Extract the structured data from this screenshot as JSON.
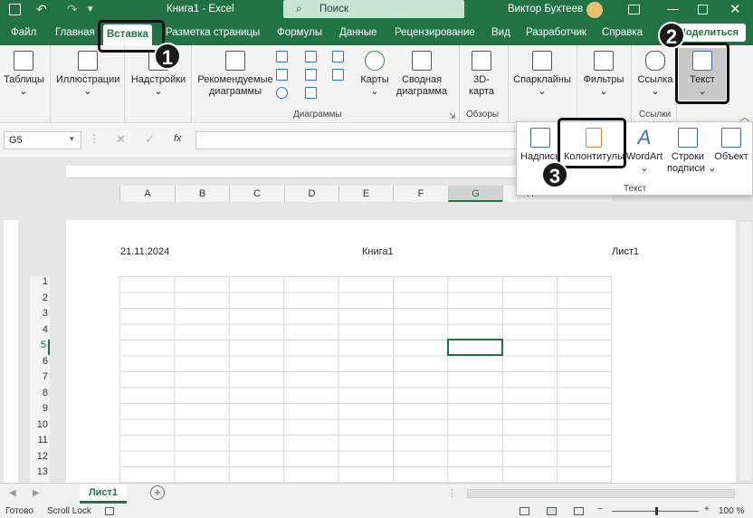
{
  "titlebar": {
    "title": "Книга1 - Excel",
    "search_placeholder": "Поиск",
    "user": "Виктор Бухтеев",
    "share": "Поделиться"
  },
  "tabs": [
    "Файл",
    "Главная",
    "Вставка",
    "Разметка страницы",
    "Формулы",
    "Данные",
    "Рецензирование",
    "Вид",
    "Разработчик",
    "Справка"
  ],
  "ribbon": {
    "tables": "Таблицы",
    "illustrations": "Иллюстрации",
    "addins": "Надстройки",
    "recommended_charts_1": "Рекомендуемые",
    "recommended_charts_2": "диаграммы",
    "maps": "Карты",
    "pivot_1": "Сводная",
    "pivot_2": "диаграмма",
    "map3d_1": "3D-",
    "map3d_2": "карта",
    "sparklines": "Спарклайны",
    "filters": "Фильтры",
    "link": "Ссылка",
    "text": "Текст",
    "group_charts": "Диаграммы",
    "group_tours": "Обзоры",
    "group_links": "Ссылки"
  },
  "formula_bar": {
    "namebox": "G5",
    "fx": "fx"
  },
  "popup": {
    "textbox": "Надпись",
    "headers": "Колонтитулы",
    "wordart": "WordArt",
    "sigline_1": "Строки",
    "sigline_2": "подписи",
    "object": "Объект",
    "group": "Текст"
  },
  "callouts": [
    "1",
    "2",
    "3"
  ],
  "columns": [
    "A",
    "B",
    "C",
    "D",
    "E",
    "F",
    "G",
    "H"
  ],
  "header": {
    "left": "21.11.2024",
    "center": "Книга1",
    "right": "Лист1"
  },
  "rows": [
    "1",
    "2",
    "3",
    "4",
    "5",
    "6",
    "7",
    "8",
    "9",
    "10",
    "11",
    "12",
    "13"
  ],
  "sheet_tab": "Лист1",
  "status": {
    "ready": "Готово",
    "scroll": "Scroll Lock",
    "zoom": "100 %"
  }
}
